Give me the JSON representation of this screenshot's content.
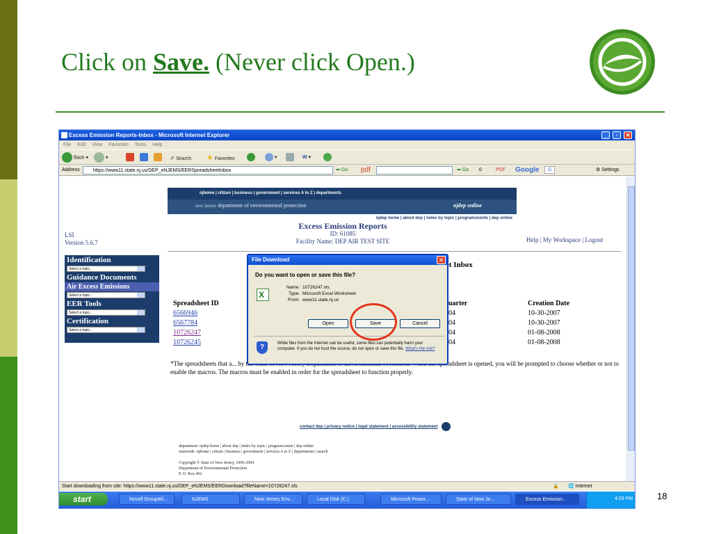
{
  "slide": {
    "title_prefix": "Click on",
    "title_emphasis": "Save.",
    "title_suffix": "(Never click Open.)",
    "page_number": "18",
    "accent_color": "#237a1e"
  },
  "browser": {
    "window_title": "Excess Emission Reports-Inbox - Microsoft Internet Explorer",
    "menu": [
      "File",
      "Edit",
      "View",
      "Favorites",
      "Tools",
      "Help"
    ],
    "toolbar": {
      "back": "Back",
      "search": "Search",
      "favorites": "Favorites"
    },
    "address_label": "Address",
    "address": "https://www11.state.nj.us/DEP_eNJEMS/EERSpreadsheetInbox",
    "go": "Go",
    "pdf_label": "pdf",
    "go2": "Go",
    "count": "0",
    "pdf2": "PDF",
    "google": "Google",
    "g_box": "G",
    "settings": "Settings",
    "status": "Start downloading from site: https://www11.state.nj.us/DEP_eNJEMS/EERDownload?fileName=10726247.xls",
    "zone": "Internet"
  },
  "site": {
    "nav": "njhome | citizen | business | government | services A to Z | departments",
    "dept": "department of environmental protection",
    "state": "new jersey",
    "brand": "njdep",
    "brand_online": "njdep online",
    "subnav": "njdep home | about dep | index by topic | programs/units | dep online",
    "lsi": "LSI",
    "version": "Version 5.6.7",
    "heading": "Excess Emission Reports",
    "id_line": "ID: 61085",
    "facility_line": "Facility Name: DEP AIR TEST SITE",
    "toplinks": "Help | My Workspace | Logout",
    "inbox_title": "et Inbox"
  },
  "sidebar": {
    "h1": "Identification",
    "h2": "Guidance Documents",
    "active": "Air Excess Emissions",
    "h3": "EER Tools",
    "h4": "Certification",
    "select_text": "Select a topic..."
  },
  "table": {
    "col1": "Spreadsheet ID",
    "col2": "uarter",
    "col3": "Creation Date",
    "rows": [
      {
        "id": "6566946",
        "q": "04",
        "date": "10-30-2007"
      },
      {
        "id": "6567784",
        "q": "04",
        "date": "10-30-2007"
      },
      {
        "id": "10726247",
        "q": "04",
        "date": "01-08-2008"
      },
      {
        "id": "10726245",
        "q": "04",
        "date": "01-08-2008"
      }
    ]
  },
  "note": "*The spreadsheets that a... by the State of New Jersey Department of Environmental Protection. When the spreadsheet is opened, you will be prompted to choose whether or not to enable the macros. The macros must be enabled in order for the spreadsheet to function properly.",
  "footer": {
    "links": "contact dep | privacy notice | legal statement | accessibility statement",
    "line1": "department: njdep home | about dep | index by topic | programs/units | dep online",
    "line2": "statewide: njhome | citizen | business | government | services A to Z | departments | search",
    "copyright": "Copyright © State of New Jersey, 1996-2004",
    "line4": "Department of Environmental Protection",
    "line5": "P. O. Box 402"
  },
  "dialog": {
    "title": "File Download",
    "question": "Do you want to open or save this file?",
    "name_label": "Name:",
    "name_value": "10726247.xls",
    "type_label": "Type:",
    "type_value": "Microsoft Excel Worksheet",
    "from_label": "From:",
    "from_value": "www11.state.nj.us",
    "open": "Open",
    "save": "Save",
    "cancel": "Cancel",
    "warning": "While files from the Internet can be useful, some files can potentially harm your computer. If you do not trust the source, do not open or save this file.",
    "risk_link": "What's the risk?"
  },
  "taskbar": {
    "start": "start",
    "tasks": [
      "Novell GroupWi...",
      "NJEMS",
      "New Jersey Env...",
      "Local Disk (C:)",
      "Microsoft Power...",
      "State of New Je...",
      "Excess Emission..."
    ],
    "clock": "4:03 PM"
  }
}
